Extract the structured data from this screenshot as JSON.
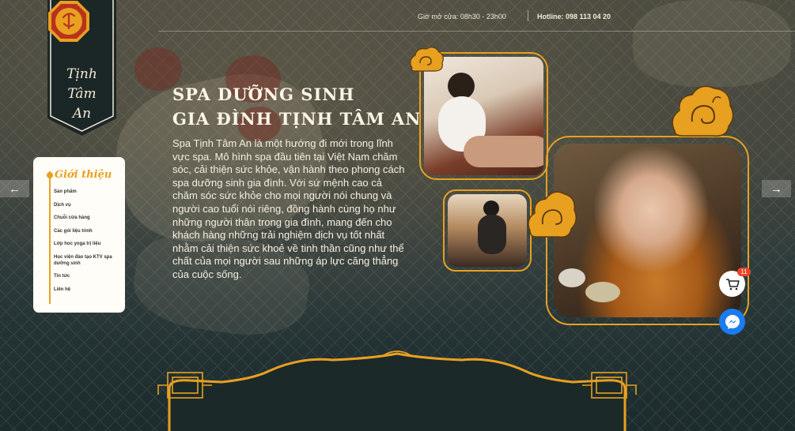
{
  "brand": {
    "name_line1": "Tịnh",
    "name_line2": "Tâm",
    "name_line3": "An"
  },
  "topbar": {
    "hours": "Giờ mở cửa: 08h30 - 23h00",
    "hotline": "Hotline: 098 113 04 20"
  },
  "sidenav": {
    "active": "Giới thiệu",
    "items": [
      "Sản phẩm",
      "Dịch vụ",
      "Chuỗi cửa hàng",
      "Các gói liệu trình",
      "Lớp học yoga trị liệu",
      "Học viện đào tạo KTV spa dưỡng sinh",
      "Tin tức",
      "Liên hệ"
    ]
  },
  "hero": {
    "title_line1": "SPA DƯỠNG SINH",
    "title_line2": "GIA ĐÌNH TỊNH TÂM AN",
    "intro": "Spa Tịnh Tâm An là một hướng đi mới trong lĩnh vực spa. Mô hình spa đầu tiên tại Việt Nam chăm sóc, cải thiện sức khỏe, vận hành theo phong cách spa dưỡng sinh gia đình. Với sứ mệnh cao cả chăm sóc sức khỏe cho mọi người nói chung và người cao tuổi nói riêng, đồng hành cùng họ như những người thân trong gia đình, mang đến cho khách hàng những trải nghiệm dịch vụ tốt nhất nhằm cải thiện sức khoẻ về tinh thần cũng như thể chất của mọi người sau những áp lực căng thẳng của cuộc sống."
  },
  "cart": {
    "count": "11"
  },
  "icons": {
    "prev": "arrow-left-icon",
    "next": "arrow-right-icon",
    "cart": "cart-icon",
    "messenger": "messenger-icon"
  },
  "colors": {
    "accent": "#e8a020",
    "background": "#1e2b2c",
    "badge": "#e8452a",
    "messenger": "#1a7cf0"
  }
}
